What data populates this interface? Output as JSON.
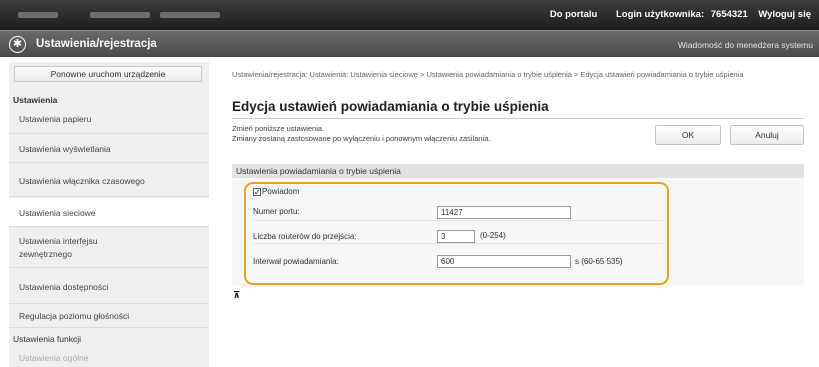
{
  "header": {
    "portal_link": "Do portalu",
    "login_label": "Login użytkownika:",
    "login_user": "7654321",
    "logout_link": "Wyloguj się"
  },
  "titlebar": {
    "logo_icon": "canon-remote-ui-icon",
    "title": "Ustawienia/rejestracja",
    "mail_link": "Wiadomość do menedżera systemu"
  },
  "sidebar": {
    "restart_button": "Ponowne uruchom urządzenie",
    "settings_heading": "Ustawienia",
    "items": [
      "Ustawienia papieru",
      "Ustawienia wyświetlania",
      "Ustawienia włącznika czasowego",
      "Ustawienia sieciowe",
      "Ustawienia interfejsu zewnętrznego",
      "Ustawienia dostępności",
      "Regulacja poziomu głośności"
    ],
    "functions_heading": "Ustawienia funkcji",
    "general_item": "Ustawienia ogólne"
  },
  "main": {
    "breadcrumb": "Ustawienia/rejestracja: Ustawienia: Ustawienia sieciowe > Ustawienia powiadamiania o trybie uśpienia > Edycja ustawień powiadamiania o trybie uśpienia",
    "page_title": "Edycja ustawień powiadamiania o trybie uśpienia",
    "description_line1": "Zmień poniższe ustawienia.",
    "description_line2": "Zmiany zostaną zastosowane po wyłączeniu i ponownym włączeniu zasilania.",
    "ok_button": "OK",
    "cancel_button": "Anuluj",
    "section_title": "Ustawienia powiadamiania o trybie uśpienia",
    "notify_checkbox_label": "Powiadom",
    "notify_checked": true,
    "port_label": "Numer portu:",
    "port_value": "11427",
    "routers_label": "Liczba routerów do przejścia:",
    "routers_value": "3",
    "routers_hint": "(0-254)",
    "interval_label": "Interwał powiadamiania:",
    "interval_value": "600",
    "interval_hint": "s (60-65 535)",
    "highlight_color": "#f0a020"
  }
}
